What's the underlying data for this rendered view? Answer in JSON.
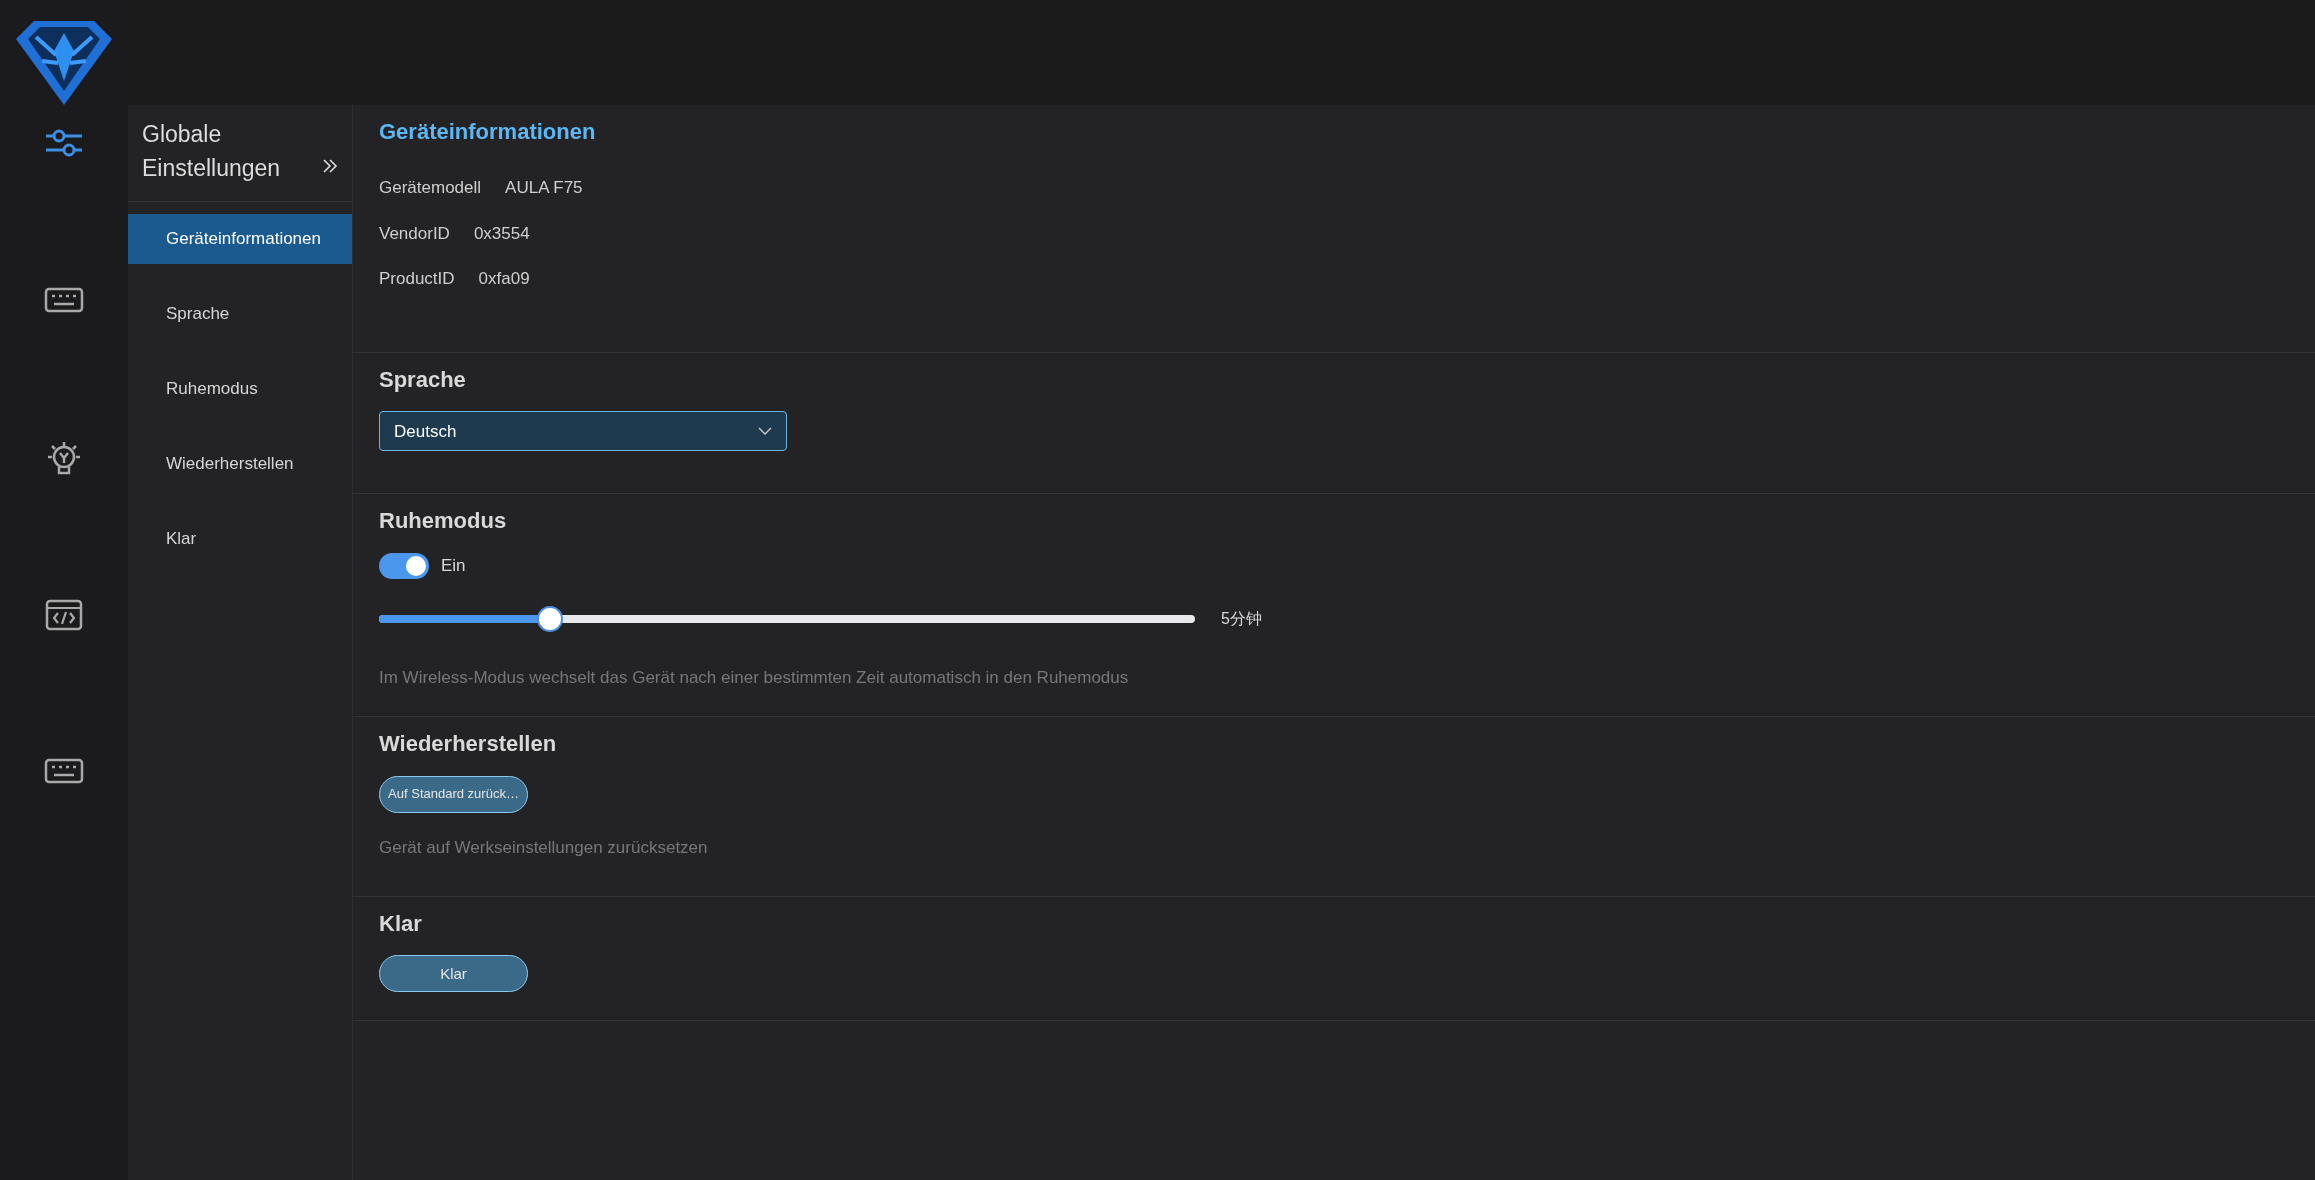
{
  "rail": [
    {
      "selected": true
    },
    {
      "selected": false
    },
    {
      "selected": false
    },
    {
      "selected": false
    },
    {
      "selected": false
    }
  ],
  "nav": {
    "title": "Globale Einstellungen",
    "items": [
      {
        "label": "Geräteinformationen",
        "selected": true
      },
      {
        "label": "Sprache",
        "selected": false
      },
      {
        "label": "Ruhemodus",
        "selected": false
      },
      {
        "label": "Wiederherstellen",
        "selected": false
      },
      {
        "label": "Klar",
        "selected": false
      }
    ]
  },
  "device_info": {
    "heading": "Geräteinformationen",
    "rows": [
      {
        "label": "Gerätemodell",
        "value": "AULA F75"
      },
      {
        "label": "VendorID",
        "value": "0x3554"
      },
      {
        "label": "ProductID",
        "value": "0xfa09"
      }
    ]
  },
  "language": {
    "heading": "Sprache",
    "value": "Deutsch"
  },
  "sleep": {
    "heading": "Ruhemodus",
    "switch": {
      "label": "Ein",
      "on": true
    },
    "slider": {
      "level": 0.21,
      "reading": "5分钟"
    },
    "description": "Im Wireless-Modus wechselt das Gerät nach einer bestimmten Zeit automatisch in den Ruhemodus"
  },
  "restore": {
    "heading": "Wiederherstellen",
    "button": "Auf Standard zurück…",
    "description": "Gerät auf Werkseinstellungen zurücksetzen"
  },
  "clear": {
    "heading": "Klar",
    "button": "Klar"
  }
}
